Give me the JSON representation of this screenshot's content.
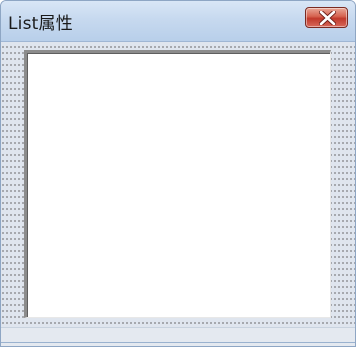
{
  "window": {
    "title": "List属性"
  },
  "titlebar": {
    "close_icon": "close-x-icon",
    "close_color": "#c0392b"
  },
  "listbox": {
    "items": []
  }
}
